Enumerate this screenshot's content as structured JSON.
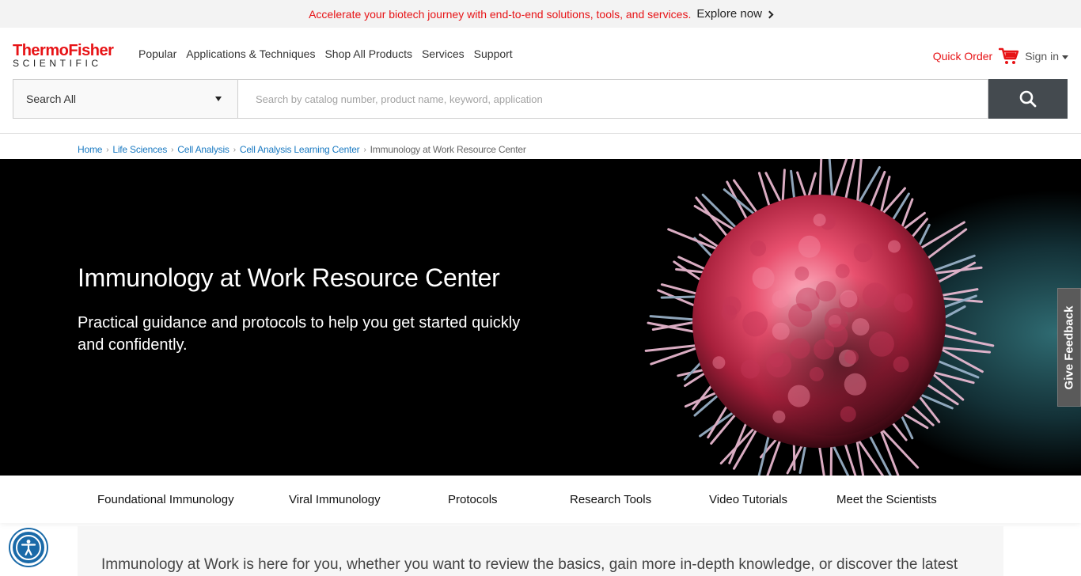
{
  "promo": {
    "text": "Accelerate your biotech journey with end-to-end solutions, tools, and services.",
    "link": "Explore now"
  },
  "logo": {
    "line1": "ThermoFisher",
    "line2": "SCIENTIFIC"
  },
  "nav": [
    "Popular",
    "Applications & Techniques",
    "Shop All Products",
    "Services",
    "Support"
  ],
  "util": {
    "quick_order": "Quick Order",
    "sign_in": "Sign in"
  },
  "search": {
    "scope": "Search All",
    "placeholder": "Search by catalog number, product name, keyword, application"
  },
  "breadcrumb": {
    "links": [
      "Home",
      "Life Sciences",
      "Cell Analysis",
      "Cell Analysis Learning Center"
    ],
    "current": "Immunology at Work Resource Center"
  },
  "hero": {
    "title": "Immunology at Work Resource Center",
    "subtitle": "Practical guidance and protocols to help you get started quickly and confidently."
  },
  "feedback": "Give Feedback",
  "tabs": [
    "Foundational Immunology",
    "Viral Immunology",
    "Protocols",
    "Research Tools",
    "Video Tutorials",
    "Meet the Scientists"
  ],
  "content": {
    "intro": "Immunology at Work is here for you, whether you want to review the basics, gain more in-depth knowledge, or discover the latest"
  },
  "colors": {
    "brand_red": "#e71316",
    "link_blue": "#1a7ac2",
    "search_button": "#444a4f"
  }
}
